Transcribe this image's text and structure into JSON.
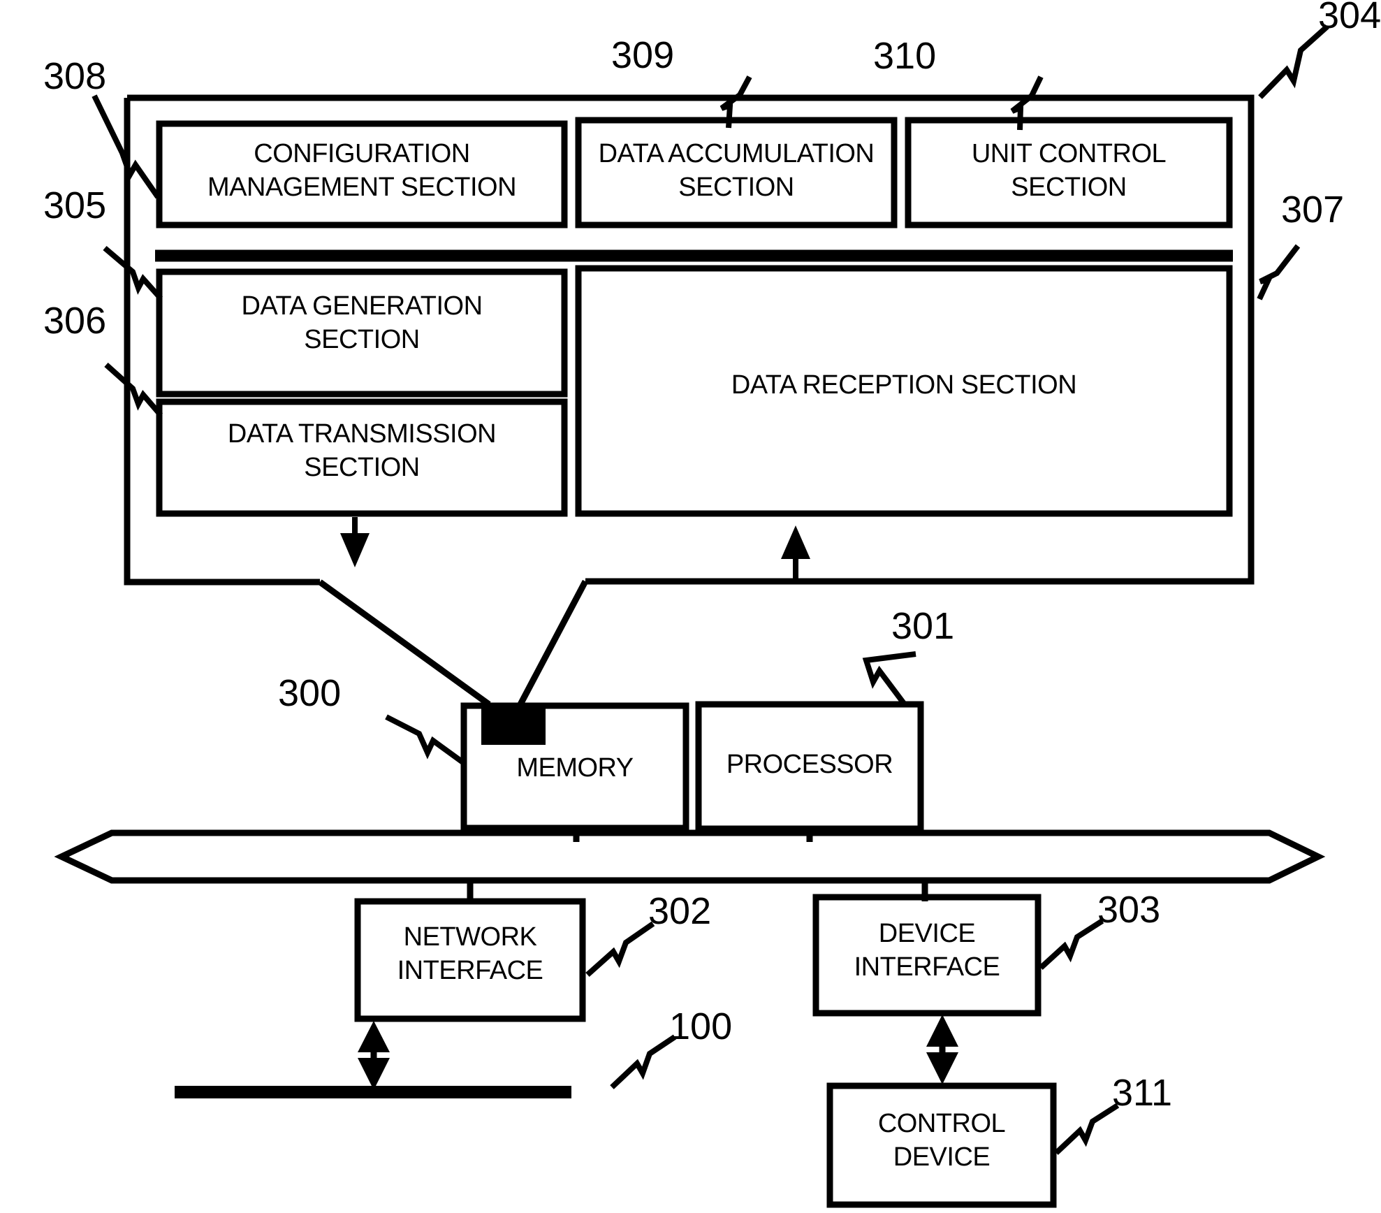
{
  "figure": {
    "type": "patent-block-diagram",
    "background": "#ffffff",
    "ink_color": "#000000"
  },
  "blocks": {
    "configuration_management": "CONFIGURATION\nMANAGEMENT SECTION",
    "configuration_management_line1": "CONFIGURATION",
    "configuration_management_line2": "MANAGEMENT SECTION",
    "data_accumulation_line1": "DATA ACCUMULATION",
    "data_accumulation_line2": "SECTION",
    "unit_control_line1": "UNIT CONTROL",
    "unit_control_line2": "SECTION",
    "data_generation_line1": "DATA GENERATION",
    "data_generation_line2": "SECTION",
    "data_transmission_line1": "DATA TRANSMISSION",
    "data_transmission_line2": "SECTION",
    "data_reception": "DATA RECEPTION SECTION",
    "memory": "MEMORY",
    "processor": "PROCESSOR",
    "network_interface_line1": "NETWORK",
    "network_interface_line2": "INTERFACE",
    "device_interface_line1": "DEVICE",
    "device_interface_line2": "INTERFACE",
    "control_device_line1": "CONTROL",
    "control_device_line2": "DEVICE"
  },
  "reference_numerals": {
    "outer_unit": "304",
    "configuration_management": "308",
    "data_accumulation": "309",
    "unit_control": "310",
    "data_generation": "305",
    "data_transmission": "306",
    "data_reception": "307",
    "memory": "300",
    "processor": "301",
    "network_interface": "302",
    "device_interface": "303",
    "network": "100",
    "control_device": "311"
  }
}
